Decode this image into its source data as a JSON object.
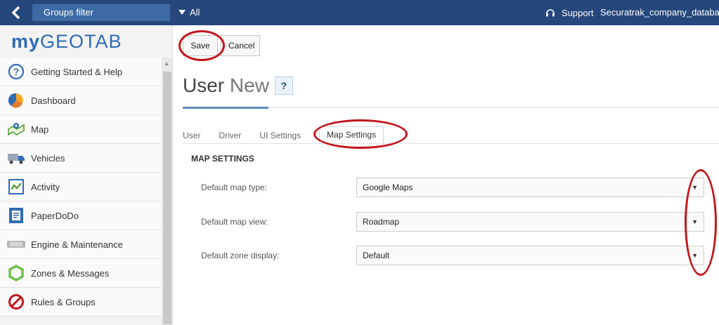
{
  "topbar": {
    "groups_filter": "Groups filter",
    "all_label": "All",
    "support_label": "Support",
    "company": "Securatrak_company_database"
  },
  "logo": {
    "my": "my",
    "geotab": "GEOTAB"
  },
  "sidebar": {
    "items": [
      {
        "label": "Getting Started & Help",
        "icon": "help-circle-icon"
      },
      {
        "label": "Dashboard",
        "icon": "pie-chart-icon"
      },
      {
        "label": "Map",
        "icon": "map-pin-icon"
      },
      {
        "label": "Vehicles",
        "icon": "truck-icon"
      },
      {
        "label": "Activity",
        "icon": "activity-chart-icon"
      },
      {
        "label": "PaperDoDo",
        "icon": "paper-document-icon"
      },
      {
        "label": "Engine & Maintenance",
        "icon": "engine-icon"
      },
      {
        "label": "Zones & Messages",
        "icon": "zone-polygon-icon"
      },
      {
        "label": "Rules & Groups",
        "icon": "no-entry-icon"
      }
    ]
  },
  "toolbar": {
    "save_label": "Save",
    "cancel_label": "Cancel"
  },
  "page": {
    "title_main": "User",
    "title_new": "New",
    "help_label": "?"
  },
  "tabs": [
    {
      "label": "User"
    },
    {
      "label": "Driver"
    },
    {
      "label": "UI Settings"
    },
    {
      "label": "Map Settings",
      "active": true
    }
  ],
  "section": {
    "title": "MAP SETTINGS"
  },
  "form": {
    "rows": [
      {
        "label": "Default map type:",
        "value": "Google Maps"
      },
      {
        "label": "Default map view:",
        "value": "Roadmap"
      },
      {
        "label": "Default zone display:",
        "value": "Default"
      }
    ]
  },
  "colors": {
    "topbar": "#25477b",
    "accent": "#5f8ac2",
    "annotation": "#c4161c"
  }
}
